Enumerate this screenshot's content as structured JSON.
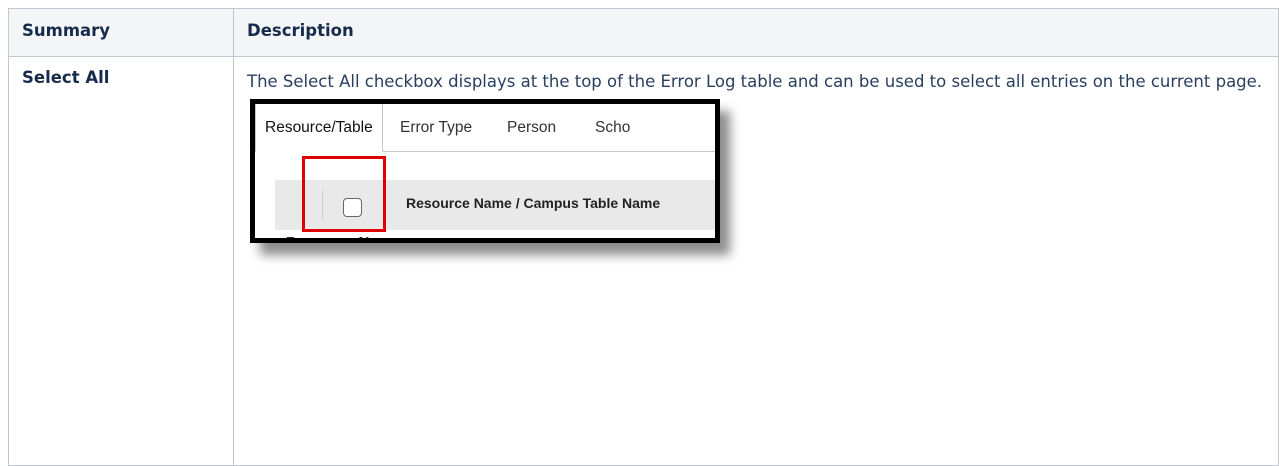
{
  "table": {
    "headers": [
      "Summary",
      "Description"
    ],
    "rows": [
      {
        "summary": "Select All",
        "description": "The Select All checkbox displays at the top of the Error Log table and can be used to select all entries on the current page."
      }
    ]
  },
  "screenshot": {
    "tabs": [
      "Resource/Table",
      "Error Type",
      "Person",
      "Scho"
    ],
    "active_tab": "Resource/Table",
    "column_header": "Resource Name / Campus Table Name",
    "group_row": "Resource Name",
    "caret_icon": "caret-down-icon",
    "checkbox_checked": false,
    "highlight_color": "#e00000"
  }
}
